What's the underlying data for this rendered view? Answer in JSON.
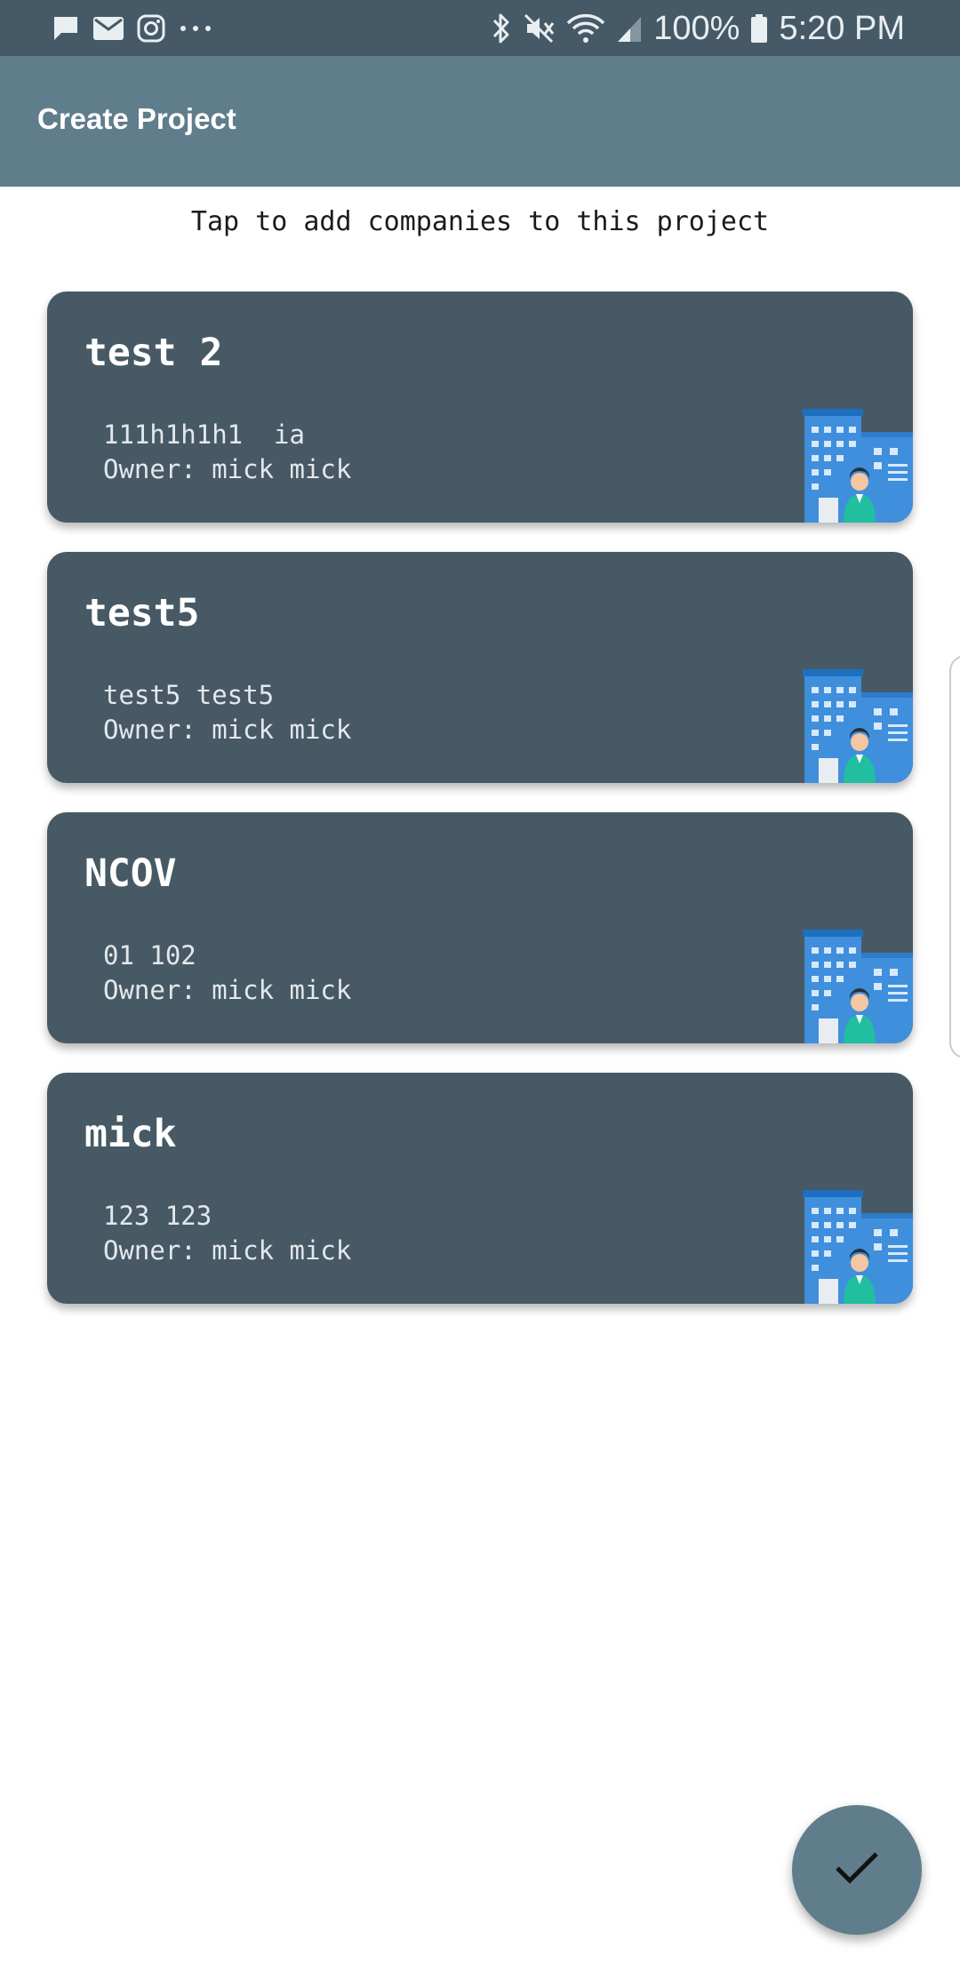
{
  "status_bar": {
    "battery": "100%",
    "time": "5:20 PM",
    "left_icons": [
      "message-icon",
      "mail-icon",
      "instagram-icon",
      "more-dots-icon"
    ],
    "right_icons": [
      "bluetooth-icon",
      "mute-icon",
      "wifi-icon",
      "signal-icon",
      "battery-icon"
    ]
  },
  "app_bar": {
    "title": "Create Project"
  },
  "instruction": "Tap to add companies to this project",
  "companies": [
    {
      "name": "test 2",
      "subtitle": "111h1h1h1  ia",
      "owner": "Owner: mick mick"
    },
    {
      "name": "test5",
      "subtitle": "test5 test5",
      "owner": "Owner: mick mick"
    },
    {
      "name": "NCOV",
      "subtitle": "01 102",
      "owner": "Owner: mick mick"
    },
    {
      "name": "mick",
      "subtitle": "123 123",
      "owner": "Owner: mick mick"
    }
  ],
  "fab": {
    "icon": "check-icon"
  },
  "colors": {
    "status_bar": "#455a66",
    "app_bar": "#607d8c",
    "card": "#475965",
    "fab": "#607d8c"
  }
}
